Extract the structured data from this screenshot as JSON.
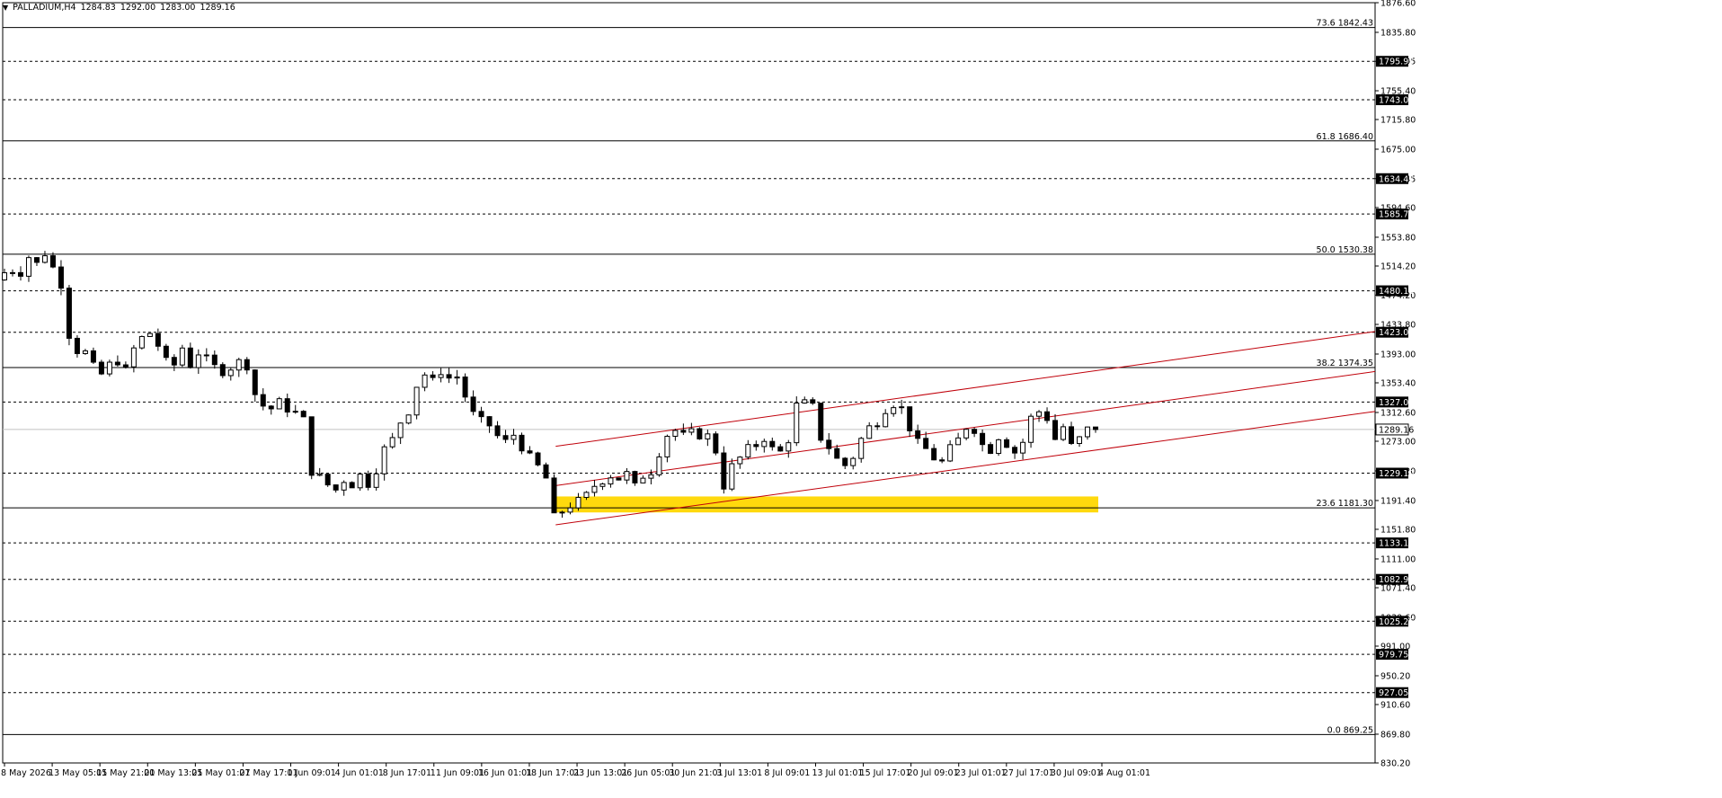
{
  "header": {
    "symbol": "PALLADIUM,H4",
    "open": "1284.83",
    "high": "1292.00",
    "low": "1283.00",
    "close": "1289.16"
  },
  "chart_data": {
    "type": "candlestick",
    "symbol": "PALLADIUM",
    "timeframe": "H4",
    "ylim": [
      830.2,
      1876.6
    ],
    "y_tick_labels": [
      "1876.60",
      "1835.80",
      "1795.95",
      "1755.40",
      "1715.80",
      "1675.00",
      "1634.45",
      "1594.60",
      "1553.80",
      "1514.20",
      "1474.20",
      "1433.80",
      "1393.00",
      "1353.40",
      "1312.60",
      "1273.00",
      "1232.20",
      "1191.40",
      "1151.80",
      "1111.00",
      "1071.40",
      "1030.60",
      "991.00",
      "950.20",
      "910.60",
      "869.80",
      "830.20"
    ],
    "x_tick_labels": [
      "8 May 2026",
      "13 May 05:01",
      "15 May 21:01",
      "20 May 13:01",
      "25 May 01:01",
      "27 May 17:01",
      "1 Jun 09:01",
      "4 Jun 01:01",
      "8 Jun 17:01",
      "11 Jun 09:01",
      "16 Jun 01:01",
      "18 Jun 17:01",
      "23 Jun 13:01",
      "26 Jun 05:01",
      "30 Jun 21:01",
      "3 Jul 13:01",
      "8 Jul 09:01",
      "13 Jul 01:01",
      "15 Jul 17:01",
      "20 Jul 09:01",
      "23 Jul 01:01",
      "27 Jul 17:01",
      "30 Jul 09:01",
      "4 Aug 01:01"
    ],
    "current_price": "1289.16",
    "horizontal_levels": [
      "1795.95",
      "1743.00",
      "1634.45",
      "1585.75",
      "1480.10",
      "1423.05",
      "1327.00",
      "1229.10",
      "1133.10",
      "1082.90",
      "1025.25",
      "979.75",
      "927.05"
    ],
    "fibonacci_levels": [
      {
        "ratio": "73.6",
        "price": "1842.43"
      },
      {
        "ratio": "61.8",
        "price": "1686.40"
      },
      {
        "ratio": "50.0",
        "price": "1530.38"
      },
      {
        "ratio": "38.2",
        "price": "1374.35"
      },
      {
        "ratio": "23.6",
        "price": "1181.30"
      },
      {
        "ratio": "0.0",
        "price": "869.25"
      }
    ],
    "support_zone": {
      "from_price": 1175,
      "to_price": 1197,
      "color": "#FFD700"
    },
    "trend_channel": {
      "color": "#C0000A",
      "lines": [
        {
          "start": {
            "date": "23 Jun 13:01",
            "price": 1266
          },
          "end": {
            "date": "right edge",
            "price": 1424
          }
        },
        {
          "start": {
            "date": "23 Jun 13:01",
            "price": 1212
          },
          "end": {
            "date": "right edge",
            "price": 1369
          }
        },
        {
          "start": {
            "date": "23 Jun 13:01",
            "price": 1158
          },
          "end": {
            "date": "right edge",
            "price": 1314
          }
        }
      ]
    },
    "price_path": [
      [
        0,
        1495
      ],
      [
        1.5,
        1510
      ],
      [
        3,
        1506
      ],
      [
        4,
        1527
      ],
      [
        5.5,
        1512
      ],
      [
        6,
        1532
      ],
      [
        7,
        1512
      ],
      [
        8,
        1490
      ],
      [
        9,
        1420
      ],
      [
        10,
        1398
      ],
      [
        11,
        1395
      ],
      [
        12,
        1375
      ],
      [
        13,
        1365
      ],
      [
        14,
        1378
      ],
      [
        14.5,
        1370
      ],
      [
        15,
        1384
      ],
      [
        15.5,
        1390
      ],
      [
        16,
        1370
      ],
      [
        17,
        1400
      ],
      [
        18,
        1415
      ],
      [
        19,
        1422
      ],
      [
        20,
        1405
      ],
      [
        21,
        1382
      ],
      [
        22,
        1378
      ],
      [
        23,
        1402
      ],
      [
        24,
        1378
      ],
      [
        25,
        1395
      ],
      [
        26,
        1385
      ],
      [
        27,
        1375
      ],
      [
        28,
        1370
      ],
      [
        29,
        1375
      ],
      [
        30,
        1382
      ],
      [
        31,
        1378
      ],
      [
        32,
        1338
      ],
      [
        33,
        1322
      ],
      [
        34,
        1318
      ],
      [
        35,
        1326
      ],
      [
        36,
        1318
      ],
      [
        37,
        1312
      ],
      [
        37.5,
        1330
      ],
      [
        38,
        1302
      ],
      [
        39,
        1232
      ],
      [
        40,
        1223
      ],
      [
        41,
        1213
      ],
      [
        42,
        1206
      ],
      [
        43,
        1220
      ],
      [
        44,
        1214
      ],
      [
        45,
        1226
      ],
      [
        46,
        1215
      ],
      [
        47,
        1235
      ],
      [
        48,
        1262
      ],
      [
        49,
        1275
      ],
      [
        50,
        1300
      ],
      [
        51,
        1315
      ],
      [
        52,
        1350
      ],
      [
        53,
        1365
      ],
      [
        54,
        1355
      ],
      [
        55,
        1370
      ],
      [
        55.5,
        1378
      ],
      [
        56,
        1360
      ],
      [
        57,
        1362
      ],
      [
        58,
        1335
      ],
      [
        59,
        1310
      ],
      [
        60,
        1300
      ],
      [
        61,
        1295
      ],
      [
        62,
        1280
      ],
      [
        63,
        1272
      ],
      [
        64,
        1282
      ],
      [
        65,
        1266
      ],
      [
        66,
        1250
      ],
      [
        67,
        1238
      ],
      [
        68,
        1222
      ],
      [
        68.5,
        1163
      ],
      [
        69,
        1168
      ],
      [
        70,
        1177
      ],
      [
        71,
        1185
      ],
      [
        72,
        1190
      ],
      [
        73,
        1198
      ],
      [
        74,
        1212
      ],
      [
        75,
        1220
      ],
      [
        76,
        1226
      ],
      [
        77,
        1222
      ],
      [
        78,
        1228
      ],
      [
        79,
        1210
      ],
      [
        80,
        1226
      ],
      [
        81,
        1232
      ],
      [
        82,
        1258
      ],
      [
        83,
        1282
      ],
      [
        84,
        1288
      ],
      [
        85,
        1280
      ],
      [
        86,
        1284
      ],
      [
        87,
        1282
      ],
      [
        88,
        1280
      ],
      [
        89,
        1260
      ],
      [
        90,
        1212
      ],
      [
        91,
        1238
      ],
      [
        92,
        1250
      ],
      [
        93,
        1262
      ],
      [
        94,
        1268
      ],
      [
        95,
        1278
      ],
      [
        96,
        1262
      ],
      [
        97,
        1258
      ],
      [
        98,
        1276
      ],
      [
        99,
        1322
      ],
      [
        100,
        1325
      ],
      [
        101,
        1320
      ],
      [
        101.5,
        1310
      ],
      [
        102,
        1278
      ],
      [
        103,
        1265
      ],
      [
        104,
        1248
      ],
      [
        105,
        1240
      ],
      [
        106,
        1252
      ],
      [
        107,
        1276
      ],
      [
        108,
        1292
      ],
      [
        109,
        1300
      ],
      [
        110,
        1318
      ],
      [
        110.5,
        1330
      ],
      [
        111,
        1325
      ],
      [
        112,
        1318
      ],
      [
        113,
        1292
      ],
      [
        114,
        1270
      ],
      [
        115,
        1262
      ],
      [
        116,
        1250
      ],
      [
        117,
        1244
      ],
      [
        118,
        1262
      ],
      [
        119,
        1275
      ],
      [
        120,
        1293
      ],
      [
        121,
        1290
      ],
      [
        122,
        1268
      ],
      [
        123,
        1262
      ],
      [
        124,
        1280
      ],
      [
        125,
        1270
      ],
      [
        126,
        1258
      ],
      [
        127,
        1272
      ],
      [
        128,
        1305
      ],
      [
        129,
        1314
      ],
      [
        130,
        1305
      ],
      [
        131,
        1276
      ],
      [
        132,
        1293
      ],
      [
        133,
        1266
      ],
      [
        134,
        1276
      ],
      [
        135,
        1289
      ]
    ]
  },
  "axis": {
    "price_labels": [
      "1876.60",
      "1835.80",
      "1795.95",
      "1755.40",
      "1715.80",
      "1675.00",
      "1634.45",
      "1594.60",
      "1553.80",
      "1514.20",
      "1474.20",
      "1433.80",
      "1393.00",
      "1353.40",
      "1312.60",
      "1273.00",
      "1232.20",
      "1191.40",
      "1151.80",
      "1111.00",
      "1071.40",
      "1030.60",
      "991.00",
      "950.20",
      "910.60",
      "869.80",
      "830.20"
    ],
    "time_labels": [
      "8 May 2026",
      "13 May 05:01",
      "15 May 21:01",
      "20 May 13:01",
      "25 May 01:01",
      "27 May 17:01",
      "1 Jun 09:01",
      "4 Jun 01:01",
      "8 Jun 17:01",
      "11 Jun 09:01",
      "16 Jun 01:01",
      "18 Jun 17:01",
      "23 Jun 13:01",
      "26 Jun 05:01",
      "30 Jun 21:01",
      "3 Jul 13:01",
      "8 Jul 09:01",
      "13 Jul 01:01",
      "15 Jul 17:01",
      "20 Jul 09:01",
      "23 Jul 01:01",
      "27 Jul 17:01",
      "30 Jul 09:01",
      "4 Aug 01:01"
    ]
  },
  "colors": {
    "background": "#FFFFFF",
    "candle_up": "#FFFFFF",
    "candle_down": "#000000",
    "level_line": "#000000",
    "channel": "#C0000A",
    "zone": "#FFD700",
    "current_price_line": "#C0C0C0"
  }
}
